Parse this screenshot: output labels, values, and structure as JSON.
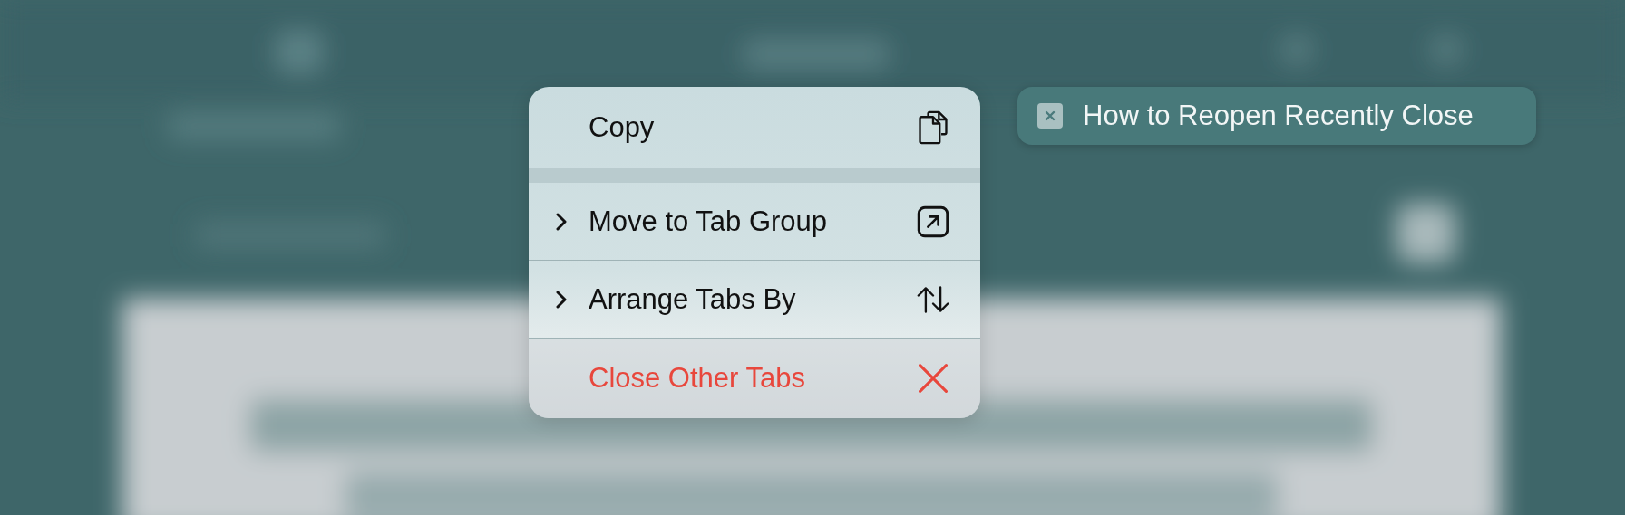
{
  "context_menu": {
    "items": [
      {
        "label": "Copy",
        "has_submenu": false,
        "destructive": false,
        "group_end": true
      },
      {
        "label": "Move to Tab Group",
        "has_submenu": true,
        "destructive": false,
        "group_end": false
      },
      {
        "label": "Arrange Tabs By",
        "has_submenu": true,
        "destructive": false,
        "group_end": false
      },
      {
        "label": "Close Other Tabs",
        "has_submenu": false,
        "destructive": true,
        "group_end": false
      }
    ]
  },
  "tab_preview": {
    "title": "How to Reopen Recently Close"
  }
}
